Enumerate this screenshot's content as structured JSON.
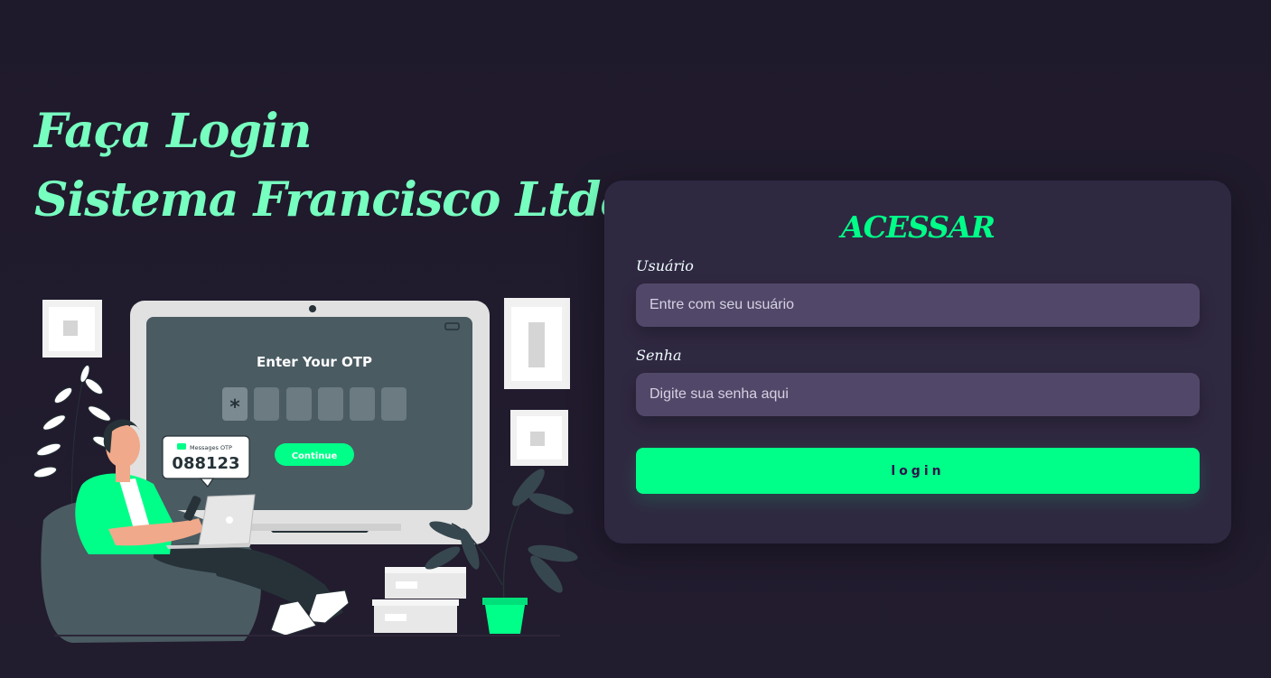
{
  "hero": {
    "line1": "Faça Login",
    "line2": "Sistema Francisco Ltda"
  },
  "illustration": {
    "otp_title": "Enter Your OTP",
    "otp_first_digit": "*",
    "continue_label": "Continue",
    "message_title": "Messages OTP",
    "message_code": "088123"
  },
  "login": {
    "title": "ACESSAR",
    "username_label": "Usuário",
    "username_placeholder": "Entre com seu usuário",
    "password_label": "Senha",
    "password_placeholder": "Digite sua senha aqui",
    "button_label": "login"
  },
  "colors": {
    "background": "#201b2c",
    "accent": "#00ff88",
    "headline": "#77ffc0",
    "card": "#2f2841",
    "input": "#514869"
  }
}
